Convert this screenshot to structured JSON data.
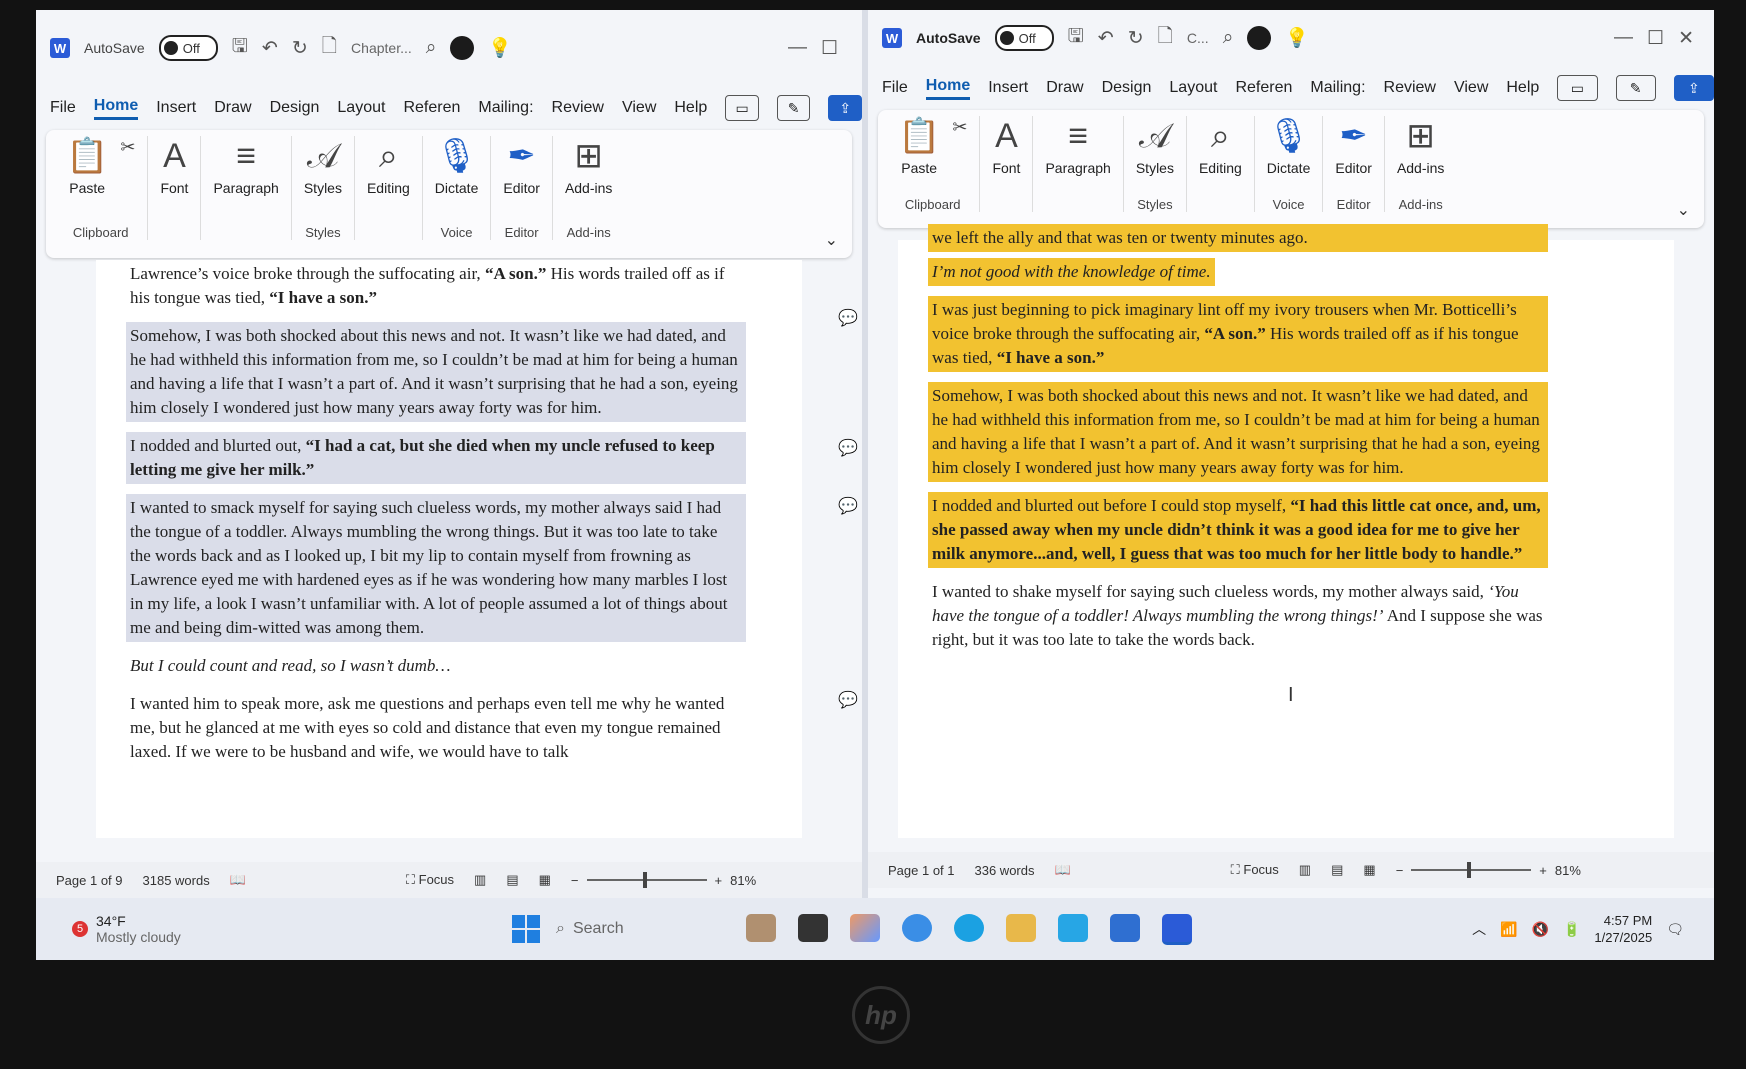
{
  "left_window": {
    "autosave_label": "AutoSave",
    "autosave_state": "Off",
    "title": "Chapter...",
    "menu": [
      "File",
      "Home",
      "Insert",
      "Draw",
      "Design",
      "Layout",
      "Referen",
      "Mailing:",
      "Review",
      "View",
      "Help"
    ],
    "ribbon": {
      "paste": "Paste",
      "font": "Font",
      "paragraph": "Paragraph",
      "styles": "Styles",
      "editing": "Editing",
      "dictate": "Dictate",
      "editor": "Editor",
      "addins": "Add-ins",
      "g_clipboard": "Clipboard",
      "g_styles": "Styles",
      "g_voice": "Voice",
      "g_editor": "Editor",
      "g_addins": "Add-ins"
    },
    "paragraphs": [
      {
        "pre": "Lawrence’s voice broke through the suffocating air, ",
        "b1": "“A son.”",
        "mid": " His words trailed off as if his tongue was tied, ",
        "b2": "“I have a son.”"
      },
      {
        "text": "Somehow, I was both shocked about this news and not. It wasn’t like we had dated, and he had withheld this information from me, so I couldn’t be mad at him for being a human and having a life that I wasn’t a part of. And it wasn’t surprising that he had a son, eyeing him closely I wondered just how many years away forty was for him."
      },
      {
        "pre": "I nodded and blurted out, ",
        "b1": "“I had a cat, but she died when my uncle refused to keep letting me give her milk.”"
      },
      {
        "text": "I wanted to smack myself for saying such clueless words, my mother always said I had the tongue of a toddler. Always mumbling the wrong things. But it was too late to take the words back and as I looked up, I bit my lip to contain myself from frowning as Lawrence eyed me with hardened eyes as if he was wondering how many marbles I lost in my life, a look I wasn’t unfamiliar with. A lot of people assumed a lot of things about me and being dim-witted was among them."
      },
      {
        "text": "But I could count and read, so I wasn’t dumb…"
      },
      {
        "text": "I wanted him to speak more, ask me questions and perhaps even tell me why he wanted me, but he glanced at me with eyes so cold and distance that even my tongue remained laxed. If we were to be husband and wife, we would have to talk"
      }
    ],
    "status": {
      "page": "Page 1 of 9",
      "words": "3185 words",
      "focus": "Focus",
      "zoom": "81%"
    }
  },
  "right_window": {
    "autosave_label": "AutoSave",
    "autosave_state": "Off",
    "title": "C...",
    "menu": [
      "File",
      "Home",
      "Insert",
      "Draw",
      "Design",
      "Layout",
      "Referen",
      "Mailing:",
      "Review",
      "View",
      "Help"
    ],
    "paragraphs": [
      {
        "text": "we left the ally and that was ten or twenty minutes ago."
      },
      {
        "text": "I’m not good with the knowledge of time."
      },
      {
        "pre": "I was just beginning to pick imaginary lint off my ivory trousers when Mr. Botticelli’s voice broke through the suffocating air, ",
        "b1": "“A son.”",
        "mid": " His words trailed off as if his tongue was tied, ",
        "b2": "“I have a son.”"
      },
      {
        "text": "Somehow, I was both shocked about this news and not. It wasn’t like we had dated, and he had withheld this information from me, so I couldn’t be mad at him for being a human and having a life that I wasn’t a part of. And it wasn’t surprising that he had a son, eyeing him closely I wondered just how many years away forty was for him."
      },
      {
        "pre": "I nodded and blurted out before I could stop myself, ",
        "b1": "“I had this little cat once, and, um, she passed away when my uncle didn’t think it was a good idea for me to give her milk anymore...and, well, I guess that was too much for her little body to handle.”"
      },
      {
        "pre": "I wanted to shake myself for saying such clueless words, my mother always said, ",
        "i1": "‘You have the tongue of a toddler! Always mumbling the wrong things!’",
        "mid": " And I suppose she was right, but it was too late to take the words back."
      }
    ],
    "status": {
      "page": "Page 1 of 1",
      "words": "336 words",
      "focus": "Focus",
      "zoom": "81%"
    }
  },
  "taskbar": {
    "weather_badge": "5",
    "temp": "34°F",
    "condition": "Mostly cloudy",
    "search": "Search",
    "time": "4:57 PM",
    "date": "1/27/2025"
  },
  "bezel_logo": "hp",
  "colors": {
    "highlight": "#f2c230",
    "selection": "#dadde9",
    "accent": "#1f5fc6"
  }
}
